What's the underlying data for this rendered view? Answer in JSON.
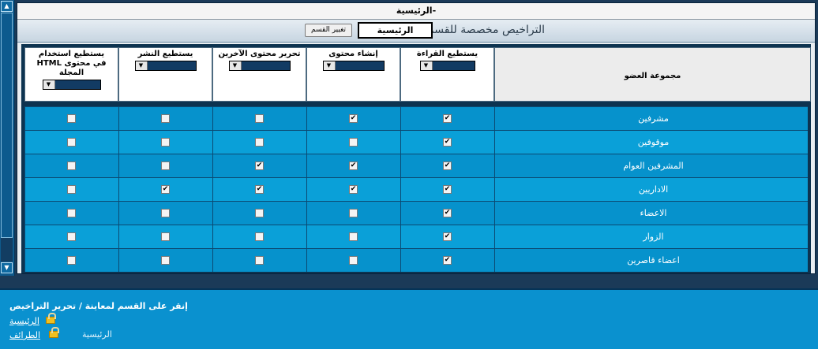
{
  "header": {
    "title": "الرئيسية-",
    "permissions_label": "التراخيص مخصصة للقسم",
    "section_name": "الرئيسية",
    "change_button": "تغيير القسم"
  },
  "table": {
    "columns": [
      {
        "label": "مجموعة العضو"
      },
      {
        "label": "يستطيع القراءة"
      },
      {
        "label": "إنشاء محتوى"
      },
      {
        "label": "تحرير محتوى الآخرين"
      },
      {
        "label": "يستطيع النشر"
      },
      {
        "label": "يستطيع استخدام HTML في محتوى المجلة"
      }
    ],
    "rows": [
      {
        "name": "مشرفين",
        "checks": [
          true,
          true,
          false,
          false,
          false
        ]
      },
      {
        "name": "موقوفين",
        "checks": [
          true,
          false,
          false,
          false,
          false
        ]
      },
      {
        "name": "المشرفين العوام",
        "checks": [
          true,
          true,
          true,
          false,
          false
        ]
      },
      {
        "name": "الاداريين",
        "checks": [
          true,
          true,
          true,
          true,
          false
        ]
      },
      {
        "name": "الاعضاء",
        "checks": [
          true,
          false,
          false,
          false,
          false
        ]
      },
      {
        "name": "الزوار",
        "checks": [
          true,
          false,
          false,
          false,
          false
        ]
      },
      {
        "name": "اعضاء قاصرين",
        "checks": [
          true,
          false,
          false,
          false,
          false
        ]
      }
    ]
  },
  "footer": {
    "instruction": "إنقر على القسم لمعاينة / تحرير التراخيص",
    "links": [
      {
        "label": "الرئيسية"
      },
      {
        "label": "الطرائف"
      }
    ],
    "current_label": "الرئيسية"
  },
  "icons": {
    "scroll_up": "▲",
    "scroll_down": "▼",
    "dropdown": "▼",
    "check": "✔",
    "lock": "lock-icon"
  },
  "colors": {
    "row_alt": "#0692cc",
    "row_norm": "#0aa0d8",
    "footer_bg": "#0a91cf"
  }
}
